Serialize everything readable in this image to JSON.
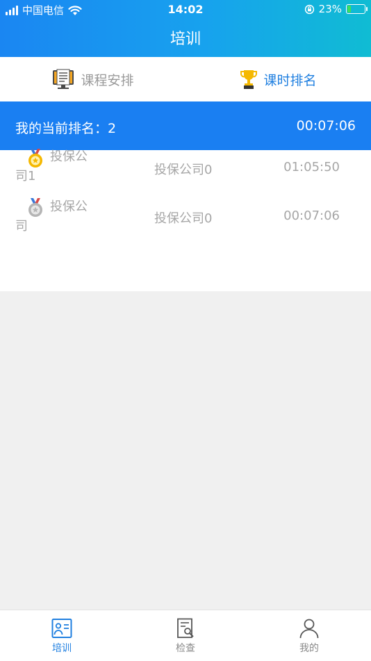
{
  "status_bar": {
    "carrier": "中国电信",
    "time": "14:02",
    "battery": "23%",
    "battery_level": 0.23
  },
  "header": {
    "title": "培训"
  },
  "tabs": [
    {
      "label": "课程安排",
      "active": false,
      "icon": "course-schedule-icon"
    },
    {
      "label": "课时排名",
      "active": true,
      "icon": "trophy-icon"
    }
  ],
  "my_rank": {
    "label": "我的当前排名：2",
    "time": "00:07:06"
  },
  "rows": [
    {
      "name": "投保公司1",
      "company": "投保公司0",
      "duration": "01:05:50",
      "medal": "gold-medal-icon"
    },
    {
      "name": "投保公司",
      "company": "投保公司0",
      "duration": "00:07:06",
      "medal": "silver-medal-icon"
    }
  ],
  "bottom_nav": [
    {
      "label": "培训",
      "active": true,
      "icon": "training-icon"
    },
    {
      "label": "检查",
      "active": false,
      "icon": "inspection-icon"
    },
    {
      "label": "我的",
      "active": false,
      "icon": "profile-icon"
    }
  ],
  "colors": {
    "primary": "#1a7ff2",
    "gradient_end": "#10bcd3",
    "inactive_text": "#9a9a9a"
  }
}
